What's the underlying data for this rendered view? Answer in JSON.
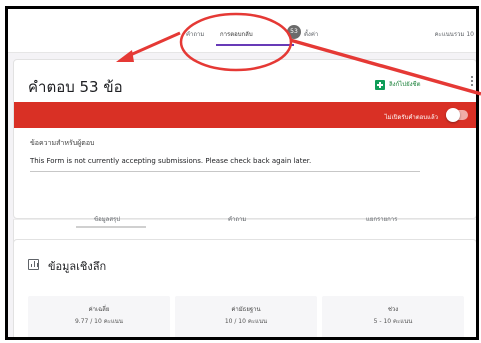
{
  "top_tabs": {
    "questions": "คำถาม",
    "responses": "การตอบกลับ",
    "response_count": "53",
    "settings": "ตั้งค่า",
    "total_points": "คะแนนรวม 10"
  },
  "responses_card": {
    "title": "คำตอบ 53 ข้อ",
    "sheets_button": "ลิงก์ไปยังชีต",
    "accepting_label": "ไม่เปิดรับคำตอบแล้ว",
    "accepting": false,
    "message_label": "ข้อความสำหรับผู้ตอบ",
    "message_text": "This Form is not currently accepting submissions. Please check back again later."
  },
  "sub_tabs": {
    "summary": "ข้อมูลสรุป",
    "question": "คำถาม",
    "individual": "แยกรายการ"
  },
  "insights": {
    "title": "ข้อมูลเชิงลึก",
    "stats": [
      {
        "name": "ค่าเฉลี่ย",
        "value": "9.77 / 10 คะแนน"
      },
      {
        "name": "ค่ามัธยฐาน",
        "value": "10 / 10 คะแนน"
      },
      {
        "name": "ช่วง",
        "value": "5 - 10 คะแนน"
      }
    ]
  },
  "colors": {
    "accent": "#673ab7",
    "banner_red": "#d93025",
    "annotation_red": "#e53935",
    "sheets_green": "#0f9d58"
  }
}
